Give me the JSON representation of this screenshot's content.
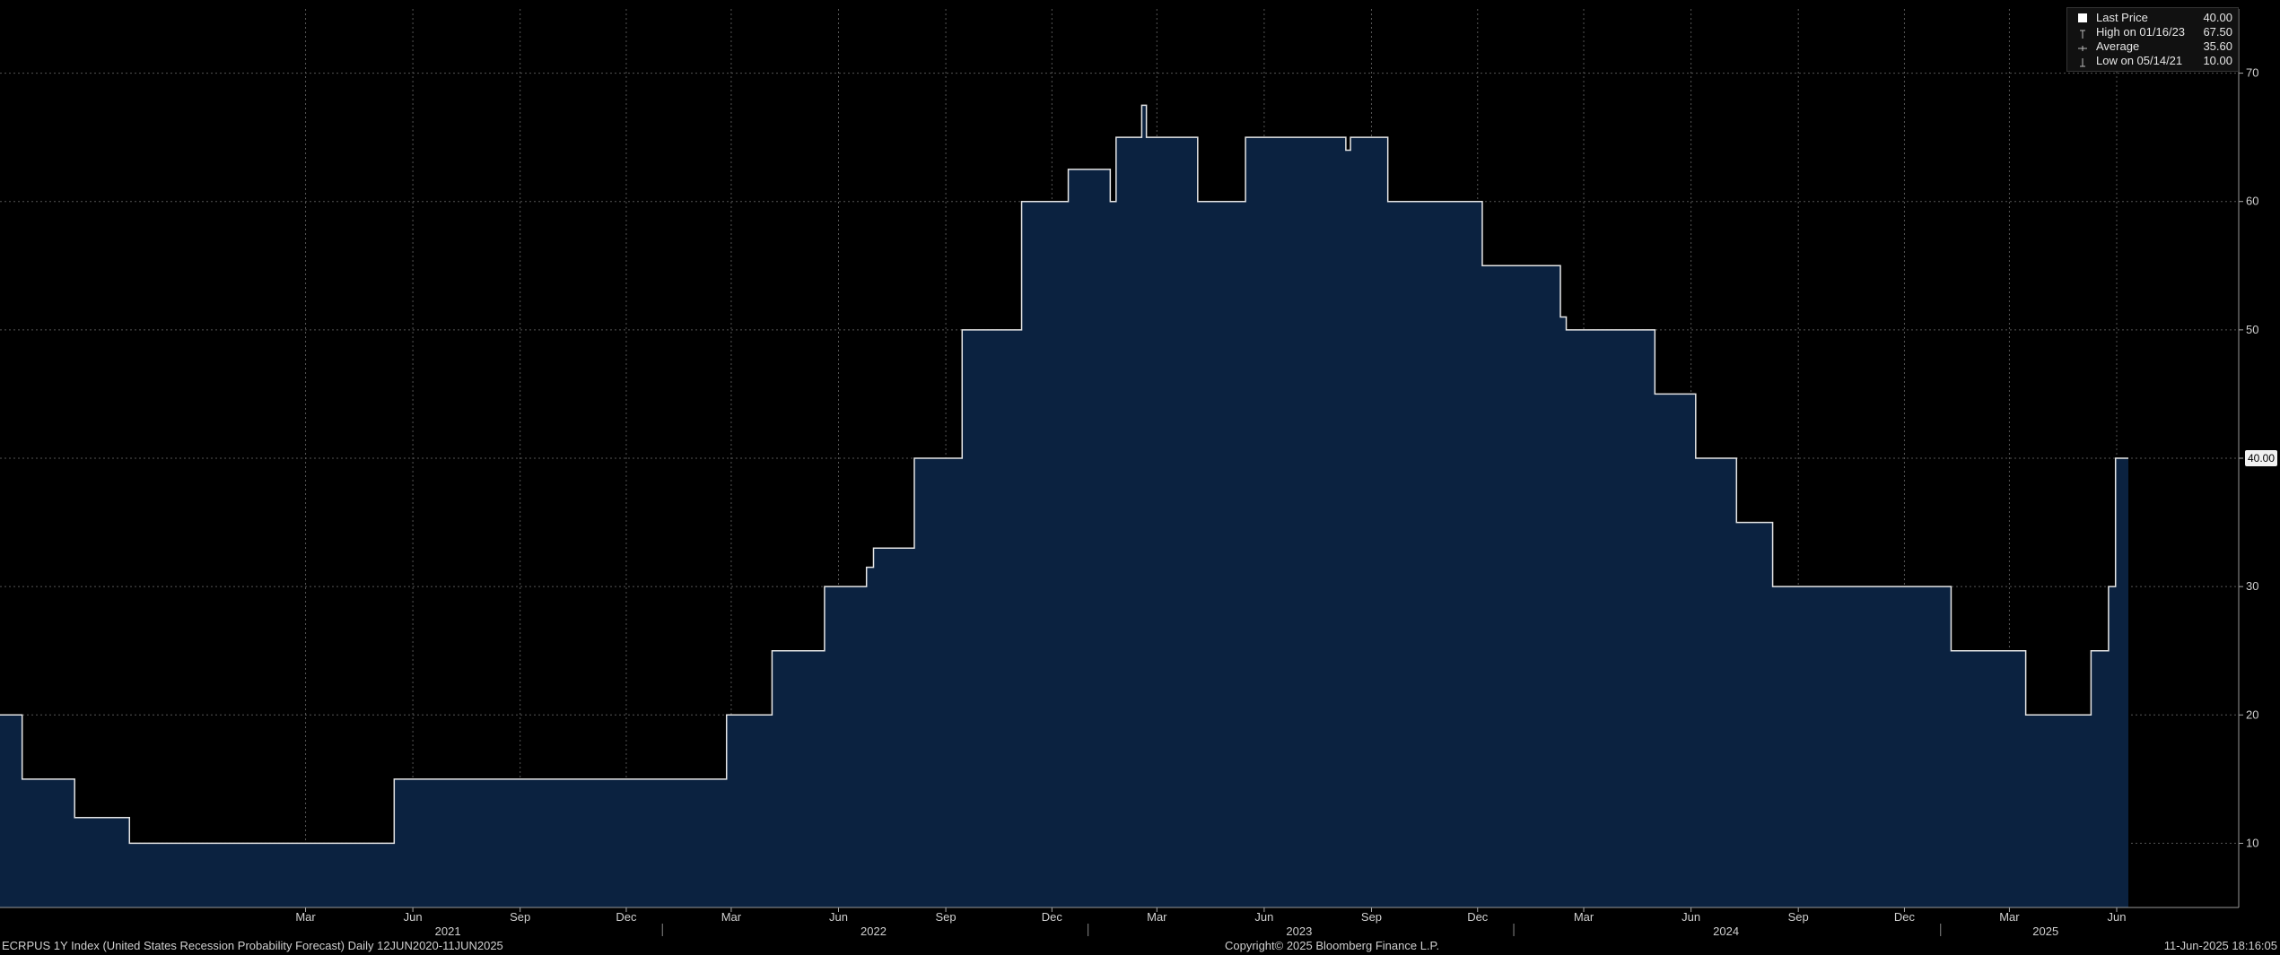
{
  "chart_data": {
    "type": "area",
    "x_range": [
      "2020-06-12",
      "2025-06-11"
    ],
    "ylim": [
      5,
      75
    ],
    "y_ticks": [
      10,
      20,
      30,
      40,
      50,
      60,
      70
    ],
    "x_months": [
      {
        "date": "2021-03-01",
        "label": "Mar"
      },
      {
        "date": "2021-06-01",
        "label": "Jun"
      },
      {
        "date": "2021-09-01",
        "label": "Sep"
      },
      {
        "date": "2021-12-01",
        "label": "Dec"
      },
      {
        "date": "2022-03-01",
        "label": "Mar"
      },
      {
        "date": "2022-06-01",
        "label": "Jun"
      },
      {
        "date": "2022-09-01",
        "label": "Sep"
      },
      {
        "date": "2022-12-01",
        "label": "Dec"
      },
      {
        "date": "2023-03-01",
        "label": "Mar"
      },
      {
        "date": "2023-06-01",
        "label": "Jun"
      },
      {
        "date": "2023-09-01",
        "label": "Sep"
      },
      {
        "date": "2023-12-01",
        "label": "Dec"
      },
      {
        "date": "2024-03-01",
        "label": "Mar"
      },
      {
        "date": "2024-06-01",
        "label": "Jun"
      },
      {
        "date": "2024-09-01",
        "label": "Sep"
      },
      {
        "date": "2024-12-01",
        "label": "Dec"
      },
      {
        "date": "2025-03-01",
        "label": "Mar"
      },
      {
        "date": "2025-06-01",
        "label": "Jun"
      }
    ],
    "x_years": [
      {
        "mid": "2021-07-01",
        "label": "2021"
      },
      {
        "mid": "2022-07-01",
        "label": "2022"
      },
      {
        "mid": "2023-07-01",
        "label": "2023"
      },
      {
        "mid": "2024-07-01",
        "label": "2024"
      },
      {
        "mid": "2025-04-01",
        "label": "2025"
      }
    ],
    "year_boundaries": [
      "2022-01-01",
      "2023-01-01",
      "2024-01-01",
      "2025-01-01"
    ],
    "grid": true,
    "fill_color": "#0b2240",
    "line_color": "#e6e6e6",
    "series": [
      {
        "step": true,
        "points": [
          [
            "2020-06-12",
            20
          ],
          [
            "2020-07-01",
            15
          ],
          [
            "2020-08-15",
            12
          ],
          [
            "2020-10-01",
            10
          ],
          [
            "2021-05-14",
            10
          ],
          [
            "2021-05-16",
            15
          ],
          [
            "2022-02-25",
            20
          ],
          [
            "2022-04-05",
            25
          ],
          [
            "2022-05-20",
            30
          ],
          [
            "2022-06-25",
            31.5
          ],
          [
            "2022-07-01",
            33
          ],
          [
            "2022-08-05",
            40
          ],
          [
            "2022-09-15",
            50
          ],
          [
            "2022-11-05",
            60
          ],
          [
            "2022-12-15",
            62.5
          ],
          [
            "2023-01-20",
            60
          ],
          [
            "2023-01-25",
            65
          ],
          [
            "2023-02-16",
            67.5
          ],
          [
            "2023-02-20",
            65
          ],
          [
            "2023-04-05",
            60
          ],
          [
            "2023-05-16",
            65
          ],
          [
            "2023-08-10",
            64
          ],
          [
            "2023-08-14",
            65
          ],
          [
            "2023-09-15",
            60
          ],
          [
            "2023-12-05",
            55
          ],
          [
            "2024-02-10",
            51
          ],
          [
            "2024-02-15",
            50
          ],
          [
            "2024-05-01",
            45
          ],
          [
            "2024-06-05",
            40
          ],
          [
            "2024-07-10",
            35
          ],
          [
            "2024-08-10",
            30
          ],
          [
            "2025-01-10",
            25
          ],
          [
            "2025-03-15",
            20
          ],
          [
            "2025-05-10",
            25
          ],
          [
            "2025-05-25",
            30
          ],
          [
            "2025-05-31",
            40
          ],
          [
            "2025-06-11",
            40
          ]
        ]
      }
    ]
  },
  "legend": {
    "last_price": {
      "label": "Last Price",
      "value": "40.00"
    },
    "high": {
      "label": "High on 01/16/23",
      "value": "67.50"
    },
    "average": {
      "label": "Average",
      "value": "35.60"
    },
    "low": {
      "label": "Low on 05/14/21",
      "value": "10.00"
    }
  },
  "current_value_label": "40.00",
  "footer": {
    "left": "ECRPUS 1Y Index (United States Recession Probability Forecast)  Daily 12JUN2020-11JUN2025",
    "center": "Copyright© 2025 Bloomberg Finance L.P.",
    "right": "11-Jun-2025 18:16:05"
  }
}
